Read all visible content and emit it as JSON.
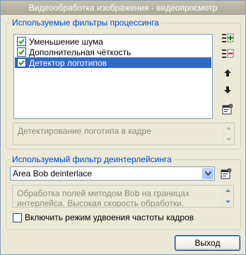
{
  "window": {
    "title": "Видеообработка изображения - видеопросмотр"
  },
  "filters_group": {
    "title": "Используемые фильтры процессинга",
    "items": [
      {
        "label": "Уменьшение шума",
        "checked": true,
        "selected": false
      },
      {
        "label": "Дополнительная чёткость",
        "checked": true,
        "selected": false
      },
      {
        "label": "Детектор логотипов",
        "checked": true,
        "selected": true
      }
    ],
    "description": "Детектирование логотипа в кадре",
    "side_buttons": [
      "add-filter-icon",
      "remove-filter-icon",
      "move-up-icon",
      "move-down-icon",
      "properties-icon"
    ]
  },
  "deinterlace_group": {
    "title": "Используемый фильтр деинтерлейсинга",
    "selected_filter": "Area Bob deinterlace",
    "description": "Обработка полей методом Bob на границах интерлейса. Высокая скорость обработки. Хорошее"
  },
  "frame_doubling": {
    "label": "Включить режим удвоения частоты кадров",
    "checked": false
  },
  "buttons": {
    "exit": "Выход"
  },
  "colors": {
    "selection": "#316ac5",
    "group_title": "#0046d5",
    "window_bg": "#ece9d8"
  }
}
